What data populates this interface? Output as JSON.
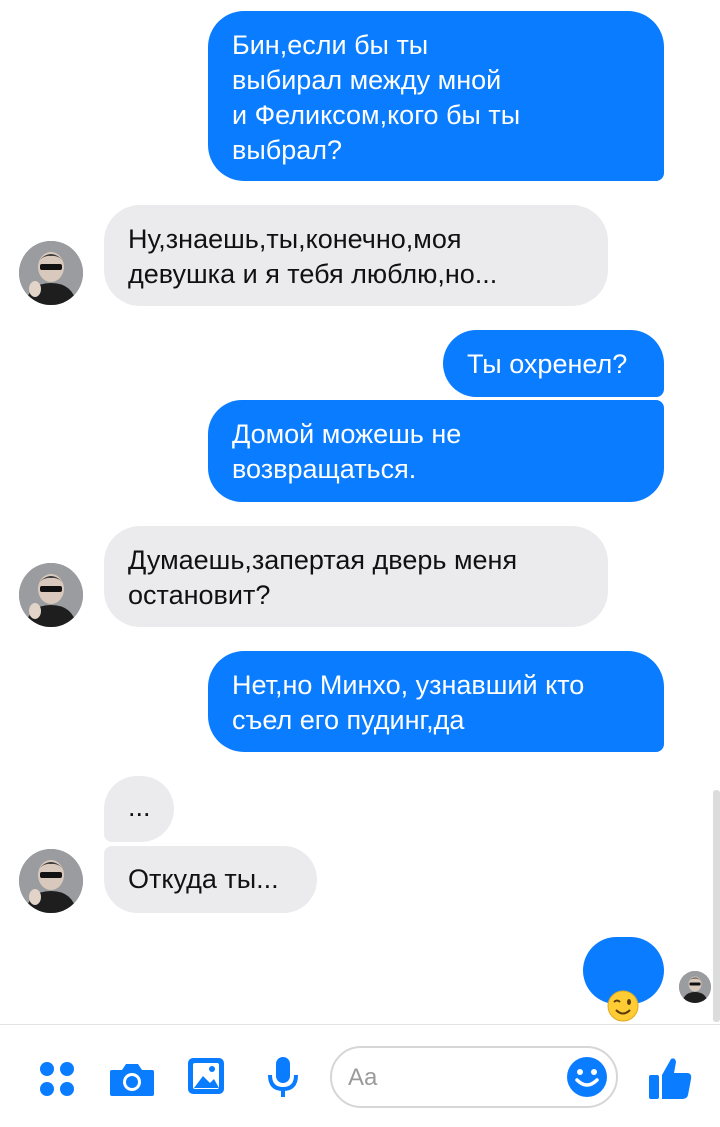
{
  "messages": [
    {
      "text": "Бин,если бы ты\nвыбирал между мной\nи Феликсом,кого бы ты\nвыбрал?"
    },
    {
      "text": "Ну,знаешь,ты,конечно,моя\nдевушка и я тебя люблю,но..."
    },
    {
      "text": "Ты охренел?"
    },
    {
      "text": "Домой можешь не\nвозвращаться."
    },
    {
      "text": "Думаешь,запертая дверь меня\nостановит?"
    },
    {
      "text": "Нет,но Минхо, узнавший кто\nсъел его пудинг,да"
    },
    {
      "text": "..."
    },
    {
      "text": "Откуда ты..."
    },
    {
      "text": "😉"
    }
  ],
  "composer": {
    "placeholder": "Aa",
    "icons": [
      "apps-icon",
      "camera-icon",
      "gallery-icon",
      "microphone-icon",
      "emoji-icon",
      "thumbs-up-icon"
    ]
  },
  "colors": {
    "outgoing_bubble": "#0a7cff",
    "incoming_bubble": "#ebebed",
    "accent": "#0a7cff"
  }
}
